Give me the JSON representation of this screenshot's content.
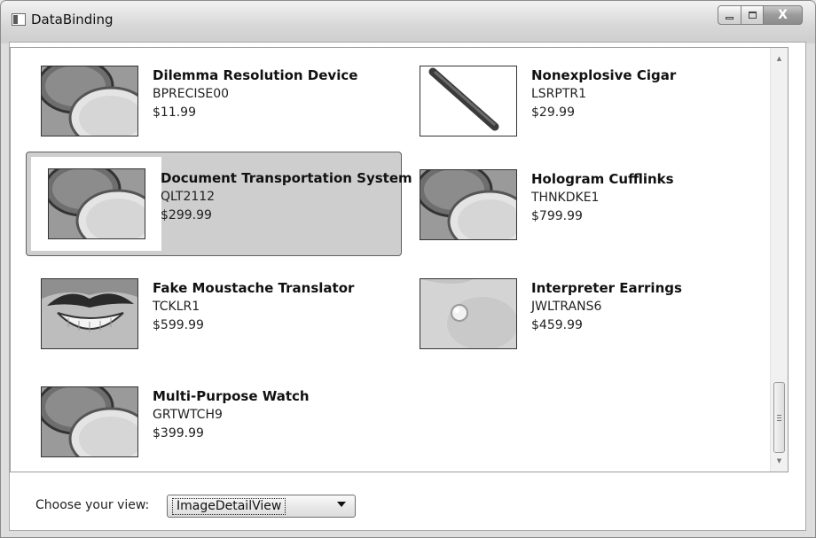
{
  "window": {
    "title": "DataBinding",
    "buttons": {
      "minimize": "–",
      "maximize": "□",
      "close": "X"
    }
  },
  "products": [
    {
      "name": "Dilemma Resolution Device",
      "code": "BPRECISE00",
      "price": "$11.99",
      "image": "compact-mirror-icon"
    },
    {
      "name": "Nonexplosive Cigar",
      "code": "LSRPTR1",
      "price": "$29.99",
      "image": "cigar-icon"
    },
    {
      "name": "Document Transportation System",
      "code": "QLT2112",
      "price": "$299.99",
      "image": "compact-mirror-icon",
      "selected": true
    },
    {
      "name": "Hologram Cufflinks",
      "code": "THNKDKE1",
      "price": "$799.99",
      "image": "compact-mirror-icon"
    },
    {
      "name": "Fake Moustache Translator",
      "code": "TCKLR1",
      "price": "$599.99",
      "image": "moustache-icon"
    },
    {
      "name": "Interpreter Earrings",
      "code": "JWLTRANS6",
      "price": "$459.99",
      "image": "earring-icon"
    },
    {
      "name": "Multi-Purpose Watch",
      "code": "GRTWTCH9",
      "price": "$399.99",
      "image": "compact-mirror-icon"
    }
  ],
  "view_selector": {
    "label": "Choose your view:",
    "selected": "ImageDetailView"
  },
  "colors": {
    "selection_background": "#cecece",
    "selection_border": "#606060"
  }
}
